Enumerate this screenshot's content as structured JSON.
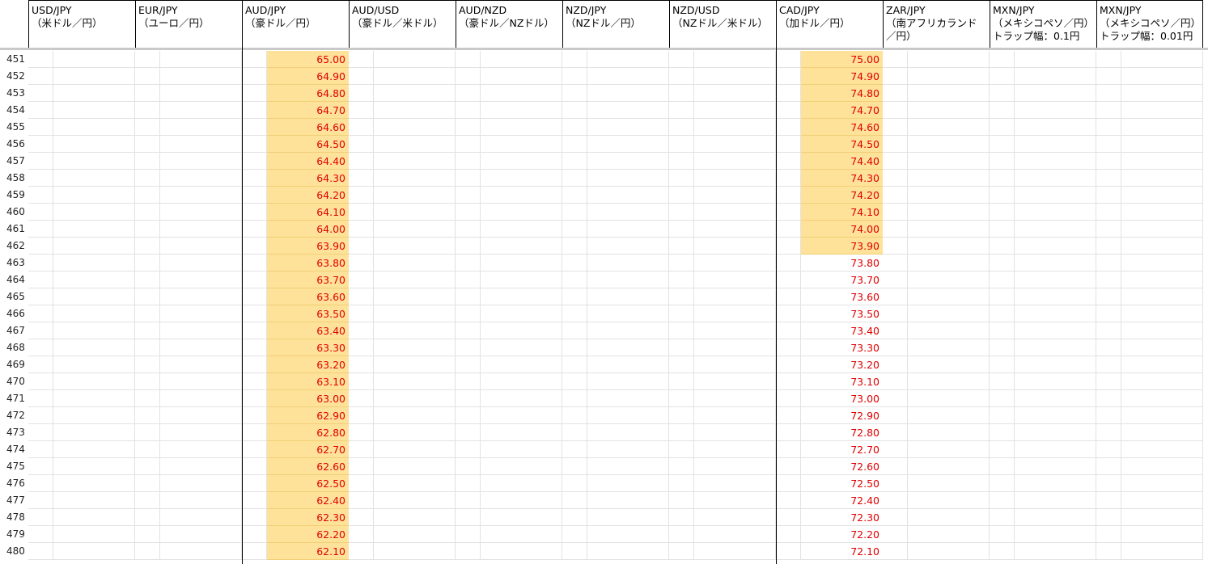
{
  "columns": [
    {
      "title": "USD/JPY\n（米ドル／円）"
    },
    {
      "title": "EUR/JPY\n（ユーロ／円）"
    },
    {
      "title": "AUD/JPY\n（豪ドル／円）"
    },
    {
      "title": "AUD/USD\n（豪ドル／米ドル）"
    },
    {
      "title": "AUD/NZD\n（豪ドル／NZドル）"
    },
    {
      "title": "NZD/JPY\n（NZドル／円）"
    },
    {
      "title": "NZD/USD\n（NZドル／米ドル）"
    },
    {
      "title": "CAD/JPY\n（加ドル／円）"
    },
    {
      "title": "ZAR/JPY\n（南アフリカランド\n／円）"
    },
    {
      "title": "MXN/JPY\n（メキシコペソ／円）\nトラップ幅：0.1円"
    },
    {
      "title": "MXN/JPY\n（メキシコペソ／円）\nトラップ幅：0.01円"
    }
  ],
  "rows": [
    {
      "num": "451",
      "aud": "65.00",
      "cad": "75.00"
    },
    {
      "num": "452",
      "aud": "64.90",
      "cad": "74.90"
    },
    {
      "num": "453",
      "aud": "64.80",
      "cad": "74.80"
    },
    {
      "num": "454",
      "aud": "64.70",
      "cad": "74.70"
    },
    {
      "num": "455",
      "aud": "64.60",
      "cad": "74.60"
    },
    {
      "num": "456",
      "aud": "64.50",
      "cad": "74.50"
    },
    {
      "num": "457",
      "aud": "64.40",
      "cad": "74.40"
    },
    {
      "num": "458",
      "aud": "64.30",
      "cad": "74.30"
    },
    {
      "num": "459",
      "aud": "64.20",
      "cad": "74.20"
    },
    {
      "num": "460",
      "aud": "64.10",
      "cad": "74.10"
    },
    {
      "num": "461",
      "aud": "64.00",
      "cad": "74.00"
    },
    {
      "num": "462",
      "aud": "63.90",
      "cad": "73.90"
    },
    {
      "num": "463",
      "aud": "63.80",
      "cad": "73.80"
    },
    {
      "num": "464",
      "aud": "63.70",
      "cad": "73.70"
    },
    {
      "num": "465",
      "aud": "63.60",
      "cad": "73.60"
    },
    {
      "num": "466",
      "aud": "63.50",
      "cad": "73.50"
    },
    {
      "num": "467",
      "aud": "63.40",
      "cad": "73.40"
    },
    {
      "num": "468",
      "aud": "63.30",
      "cad": "73.30"
    },
    {
      "num": "469",
      "aud": "63.20",
      "cad": "73.20"
    },
    {
      "num": "470",
      "aud": "63.10",
      "cad": "73.10"
    },
    {
      "num": "471",
      "aud": "63.00",
      "cad": "73.00"
    },
    {
      "num": "472",
      "aud": "62.90",
      "cad": "72.90"
    },
    {
      "num": "473",
      "aud": "62.80",
      "cad": "72.80"
    },
    {
      "num": "474",
      "aud": "62.70",
      "cad": "72.70"
    },
    {
      "num": "475",
      "aud": "62.60",
      "cad": "72.60"
    },
    {
      "num": "476",
      "aud": "62.50",
      "cad": "72.50"
    },
    {
      "num": "477",
      "aud": "62.40",
      "cad": "72.40"
    },
    {
      "num": "478",
      "aud": "62.30",
      "cad": "72.30"
    },
    {
      "num": "479",
      "aud": "62.20",
      "cad": "72.20"
    },
    {
      "num": "480",
      "aud": "62.10",
      "cad": "72.10"
    }
  ],
  "highlight": {
    "color": "#ffe29a",
    "value_color": "#e00000",
    "aud_highlighted_rows": 30,
    "cad_highlighted_rows": 12
  }
}
